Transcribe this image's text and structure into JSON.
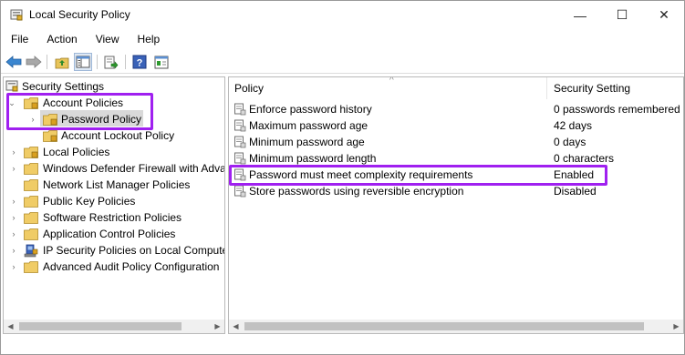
{
  "window": {
    "title": "Local Security Policy",
    "controls": {
      "minimize": "—",
      "maximize": "☐",
      "close": "✕"
    }
  },
  "menu": [
    "File",
    "Action",
    "View",
    "Help"
  ],
  "toolbar": {
    "icons": [
      "back-arrow-icon",
      "forward-arrow-icon",
      "up-folder-icon",
      "show-hide-tree-icon",
      "export-list-icon",
      "help-icon",
      "properties-icon"
    ]
  },
  "tree": {
    "root": "Security Settings",
    "items": [
      {
        "label": "Account Policies",
        "expanded": true
      },
      {
        "label": "Password Policy",
        "selected": true
      },
      {
        "label": "Account Lockout Policy"
      },
      {
        "label": "Local Policies"
      },
      {
        "label": "Windows Defender Firewall with Adva"
      },
      {
        "label": "Network List Manager Policies"
      },
      {
        "label": "Public Key Policies"
      },
      {
        "label": "Software Restriction Policies"
      },
      {
        "label": "Application Control Policies"
      },
      {
        "label": "IP Security Policies on Local Compute"
      },
      {
        "label": "Advanced Audit Policy Configuration"
      }
    ]
  },
  "list": {
    "columns": {
      "policy": "Policy",
      "setting": "Security Setting"
    },
    "rows": [
      {
        "policy": "Enforce password history",
        "setting": "0 passwords remembered"
      },
      {
        "policy": "Maximum password age",
        "setting": "42 days"
      },
      {
        "policy": "Minimum password age",
        "setting": "0 days"
      },
      {
        "policy": "Minimum password length",
        "setting": "0 characters"
      },
      {
        "policy": "Password must meet complexity requirements",
        "setting": "Enabled",
        "highlighted": true
      },
      {
        "policy": "Store passwords using reversible encryption",
        "setting": "Disabled"
      }
    ]
  },
  "colors": {
    "highlight": "#a020f0",
    "folder": "#e8c45a",
    "selection": "#d9d9d9"
  }
}
